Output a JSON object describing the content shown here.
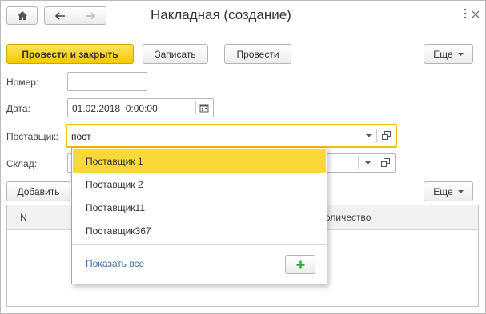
{
  "window": {
    "title": "Накладная (создание)"
  },
  "toolbar": {
    "post_and_close_label": "Провести и закрыть",
    "save_label": "Записать",
    "post_label": "Провести",
    "more_label": "Еще"
  },
  "form": {
    "number_label": "Номер:",
    "number_value": "",
    "date_label": "Дата:",
    "date_value": "01.02.2018  0:00:00",
    "supplier_label": "Поставщик:",
    "supplier_value": "пост",
    "warehouse_label": "Склад:",
    "warehouse_value": ""
  },
  "dropdown": {
    "items": [
      "Поставщик 1",
      "Поставщик 2",
      "Поставщик11",
      "Поставщик367"
    ],
    "selected_index": 0,
    "show_all_label": "Показать все"
  },
  "table_toolbar": {
    "add_label": "Добавить",
    "more_label": "Еще"
  },
  "table": {
    "columns": [
      "N",
      "Количество"
    ]
  },
  "colors": {
    "accent_yellow": "#f4c800",
    "focus_border": "#f2c200",
    "link_blue": "#3a6ea5",
    "add_green": "#3aa23a"
  }
}
